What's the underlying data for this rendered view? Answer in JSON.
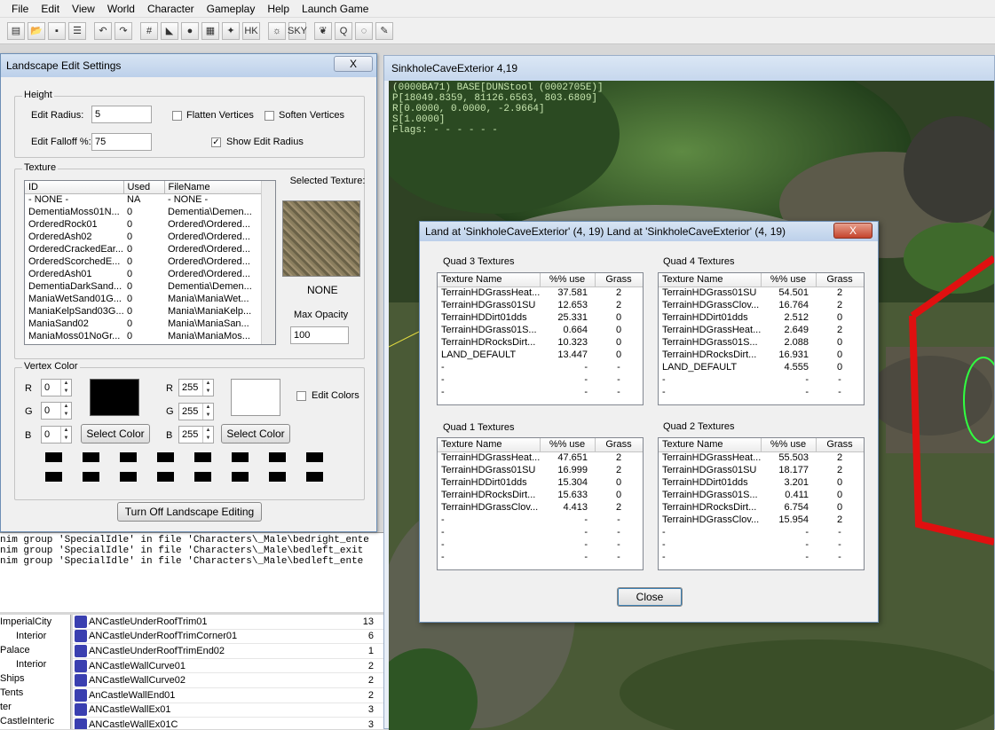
{
  "menu": [
    "File",
    "Edit",
    "View",
    "World",
    "Character",
    "Gameplay",
    "Help",
    "Launch Game"
  ],
  "toolbar_icons": [
    "new-icon",
    "open-icon",
    "save-icon",
    "properties-icon",
    "undo-icon",
    "redo-icon",
    "grid-icon",
    "angle-icon",
    "landscape-icon",
    "terrain-icon",
    "lights-icon",
    "havok-icon",
    "bulb-icon",
    "sky-icon",
    "leaf-icon",
    "query-icon",
    "dialogue-icon",
    "pencil-icon"
  ],
  "toolbar_labels": {
    "havok": "HK",
    "sky": "SKY",
    "query": "Q"
  },
  "settings": {
    "title": "Landscape Edit Settings",
    "close": "X",
    "height_label": "Height",
    "edit_radius_label": "Edit Radius:",
    "edit_radius": "5",
    "edit_falloff_label": "Edit Falloff %:",
    "edit_falloff": "75",
    "flatten_label": "Flatten Vertices",
    "soften_label": "Soften Vertices",
    "show_radius_label": "Show Edit Radius",
    "texture_label": "Texture",
    "col_id": "ID",
    "col_used": "Used",
    "col_file": "FileName",
    "textures": [
      [
        "- NONE -",
        "NA",
        "- NONE -"
      ],
      [
        "DementiaMoss01N...",
        "0",
        "Dementia\\Demen..."
      ],
      [
        "OrderedRock01",
        "0",
        "Ordered\\Ordered..."
      ],
      [
        "OrderedAsh02",
        "0",
        "Ordered\\Ordered..."
      ],
      [
        "OrderedCrackedEar...",
        "0",
        "Ordered\\Ordered..."
      ],
      [
        "OrderedScorchedE...",
        "0",
        "Ordered\\Ordered..."
      ],
      [
        "OrderedAsh01",
        "0",
        "Ordered\\Ordered..."
      ],
      [
        "DementiaDarkSand...",
        "0",
        "Dementia\\Demen..."
      ],
      [
        "ManiaWetSand01G...",
        "0",
        "Mania\\ManiaWet..."
      ],
      [
        "ManiaKelpSand03G...",
        "0",
        "Mania\\ManiaKelp..."
      ],
      [
        "ManiaSand02",
        "0",
        "Mania\\ManiaSan..."
      ],
      [
        "ManiaMoss01NoGr...",
        "0",
        "Mania\\ManiaMos..."
      ]
    ],
    "selected_texture_label": "Selected Texture:",
    "selected_texture": "NONE",
    "max_opacity_label": "Max Opacity",
    "max_opacity": "100",
    "vertex_label": "Vertex Color",
    "r_label": "R",
    "g_label": "G",
    "b_label": "B",
    "left_r": "0",
    "left_g": "0",
    "left_b": "0",
    "right_r": "255",
    "right_g": "255",
    "right_b": "255",
    "left_color": "#000000",
    "right_color": "#ffffff",
    "select_color": "Select Color",
    "edit_colors_label": "Edit Colors",
    "turn_off": "Turn Off Landscape Editing"
  },
  "log_lines": [
    "nim group 'SpecialIdle' in file 'Characters\\_Male\\bedright_ente",
    "nim group 'SpecialIdle' in file 'Characters\\_Male\\bedleft_exit",
    "nim group 'SpecialIdle' in file 'Characters\\_Male\\bedleft_ente"
  ],
  "cell_tree": [
    "ImperialCity",
    "Interior",
    "Palace",
    "Interior",
    "Ships",
    "Tents",
    "ter",
    "CastleInteric"
  ],
  "objects": [
    [
      "ANCastleUnderRoofTrim01",
      "13"
    ],
    [
      "ANCastleUnderRoofTrimCorner01",
      "6"
    ],
    [
      "ANCastleUnderRoofTrimEnd02",
      "1"
    ],
    [
      "ANCastleWallCurve01",
      "2"
    ],
    [
      "ANCastleWallCurve02",
      "2"
    ],
    [
      "AnCastleWallEnd01",
      "2"
    ],
    [
      "ANCastleWallEx01",
      "3"
    ],
    [
      "ANCastleWallEx01C",
      "3"
    ]
  ],
  "viewport": {
    "title": "SinkholeCaveExterior 4,19",
    "hud": "(0000BA71) BASE[DUNStool (0002705E)]\nP[18049.8359, 81126.6563, 803.6809]\nR[0.0000, 0.0000, -2.9664]\nS[1.0000]\nFlags: - - - - - -"
  },
  "land": {
    "title": "Land at 'SinkholeCaveExterior' (4, 19) Land at 'SinkholeCaveExterior' (4, 19)",
    "close_x": "X",
    "col_name": "Texture Name",
    "col_use": "%% use",
    "col_grass": "Grass",
    "close": "Close",
    "q3": {
      "label": "Quad 3 Textures",
      "rows": [
        [
          "TerrainHDGrassHeat...",
          "37.581",
          "2"
        ],
        [
          "TerrainHDGrass01SU",
          "12.653",
          "2"
        ],
        [
          "TerrainHDDirt01dds",
          "25.331",
          "0"
        ],
        [
          "TerrainHDGrass01S...",
          "0.664",
          "0"
        ],
        [
          "TerrainHDRocksDirt...",
          "10.323",
          "0"
        ],
        [
          "LAND_DEFAULT",
          "13.447",
          "0"
        ],
        [
          "-",
          "-",
          "-"
        ],
        [
          "-",
          "-",
          "-"
        ],
        [
          "-",
          "-",
          "-"
        ]
      ]
    },
    "q4": {
      "label": "Quad 4 Textures",
      "rows": [
        [
          "TerrainHDGrass01SU",
          "54.501",
          "2"
        ],
        [
          "TerrainHDGrassClov...",
          "16.764",
          "2"
        ],
        [
          "TerrainHDDirt01dds",
          "2.512",
          "0"
        ],
        [
          "TerrainHDGrassHeat...",
          "2.649",
          "2"
        ],
        [
          "TerrainHDGrass01S...",
          "2.088",
          "0"
        ],
        [
          "TerrainHDRocksDirt...",
          "16.931",
          "0"
        ],
        [
          "LAND_DEFAULT",
          "4.555",
          "0"
        ],
        [
          "-",
          "-",
          "-"
        ],
        [
          "-",
          "-",
          "-"
        ]
      ]
    },
    "q1": {
      "label": "Quad 1 Textures",
      "rows": [
        [
          "TerrainHDGrassHeat...",
          "47.651",
          "2"
        ],
        [
          "TerrainHDGrass01SU",
          "16.999",
          "2"
        ],
        [
          "TerrainHDDirt01dds",
          "15.304",
          "0"
        ],
        [
          "TerrainHDRocksDirt...",
          "15.633",
          "0"
        ],
        [
          "TerrainHDGrassClov...",
          "4.413",
          "2"
        ],
        [
          "-",
          "-",
          "-"
        ],
        [
          "-",
          "-",
          "-"
        ],
        [
          "-",
          "-",
          "-"
        ],
        [
          "-",
          "-",
          "-"
        ]
      ]
    },
    "q2": {
      "label": "Quad 2 Textures",
      "rows": [
        [
          "TerrainHDGrassHeat...",
          "55.503",
          "2"
        ],
        [
          "TerrainHDGrass01SU",
          "18.177",
          "2"
        ],
        [
          "TerrainHDDirt01dds",
          "3.201",
          "0"
        ],
        [
          "TerrainHDGrass01S...",
          "0.411",
          "0"
        ],
        [
          "TerrainHDRocksDirt...",
          "6.754",
          "0"
        ],
        [
          "TerrainHDGrassClov...",
          "15.954",
          "2"
        ],
        [
          "-",
          "-",
          "-"
        ],
        [
          "-",
          "-",
          "-"
        ],
        [
          "-",
          "-",
          "-"
        ]
      ]
    }
  }
}
